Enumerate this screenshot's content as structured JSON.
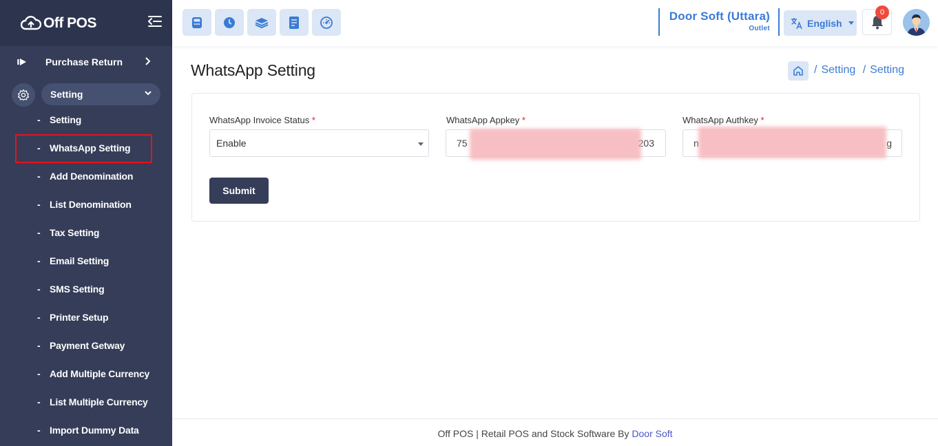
{
  "sidebar": {
    "brand": "Off POS",
    "main_item": "Purchase Return",
    "section": "Setting",
    "sub_items": [
      {
        "label": "Setting"
      },
      {
        "label": "WhatsApp Setting"
      },
      {
        "label": "Add Denomination"
      },
      {
        "label": "List Denomination"
      },
      {
        "label": "Tax Setting"
      },
      {
        "label": "Email Setting"
      },
      {
        "label": "SMS Setting"
      },
      {
        "label": "Printer Setup"
      },
      {
        "label": "Payment Getway"
      },
      {
        "label": "Add Multiple Currency"
      },
      {
        "label": "List Multiple Currency"
      },
      {
        "label": "Import Dummy Data"
      }
    ],
    "active_item": "WhatsApp Setting"
  },
  "header": {
    "toolbar_icons": [
      "calculator-icon",
      "clock-icon",
      "layers-icon",
      "document-icon",
      "dashboard-icon"
    ],
    "outlet_name": "Door Soft (Uttara)",
    "outlet_type": "Outlet",
    "language": "English",
    "notification_count": "0"
  },
  "page": {
    "title": "WhatsApp Setting",
    "breadcrumb": [
      "Setting",
      "Setting"
    ]
  },
  "form": {
    "invoice_status": {
      "label": "WhatsApp Invoice Status",
      "value": "Enable"
    },
    "appkey": {
      "label": "WhatsApp Appkey",
      "value_start": "75",
      "value_end": "203"
    },
    "authkey": {
      "label": "WhatsApp Authkey",
      "value_start": "n",
      "value_end": "g"
    },
    "required_mark": "*",
    "submit_label": "Submit"
  },
  "footer": {
    "text": "Off POS | Retail POS and Stock Software By",
    "link": "Door Soft"
  },
  "colors": {
    "sidebar": "#353d58",
    "accent": "#3a7bd5",
    "highlight": "#e5141b"
  }
}
